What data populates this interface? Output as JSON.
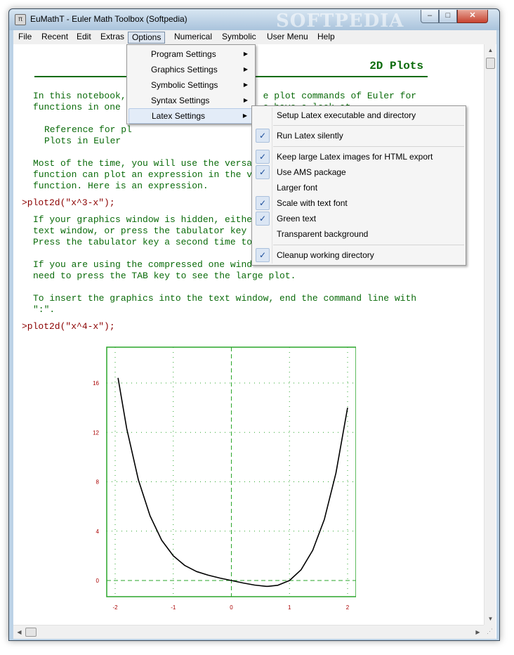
{
  "window": {
    "title": "EuMathT - Euler Math Toolbox (Softpedia)",
    "watermark": "SOFTPEDIA",
    "app_icon_glyph": "π",
    "min_glyph": "–",
    "max_glyph": "□",
    "close_glyph": "✕"
  },
  "menubar": {
    "items": [
      "File",
      "Recent",
      "Edit",
      "Extras",
      "Options",
      "Numerical",
      "Symbolic",
      "User Menu",
      "Help"
    ],
    "active": "Options"
  },
  "options_menu": {
    "items": [
      {
        "label": "Program Settings",
        "submenu": true
      },
      {
        "label": "Graphics Settings",
        "submenu": true
      },
      {
        "label": "Symbolic Settings",
        "submenu": true
      },
      {
        "label": "Syntax Settings",
        "submenu": true
      },
      {
        "label": "Latex Settings",
        "submenu": true
      }
    ],
    "highlighted": "Latex Settings"
  },
  "latex_menu": {
    "items": [
      {
        "label": "Setup Latex executable and directory",
        "checked": false
      },
      {
        "label": "Run Latex silently",
        "checked": true
      },
      {
        "label": "Keep large Latex images for HTML export",
        "checked": true
      },
      {
        "label": "Use AMS package",
        "checked": true
      },
      {
        "label": "Larger font",
        "checked": false
      },
      {
        "label": "Scale with text font",
        "checked": true
      },
      {
        "label": "Green text",
        "checked": true
      },
      {
        "label": "Transparent background",
        "checked": false
      },
      {
        "label": "Cleanup working directory",
        "checked": true
      }
    ]
  },
  "notebook": {
    "heading": "2D Plots",
    "para1_line1": "In this notebook,                         e plot commands of Euler for",
    "para1_line2": "functions in one v                        e have a look at",
    "ref_line1": "Reference for pl",
    "ref_line2": "Plots in Euler",
    "para2_line1": "Most of the time, you will use the versa",
    "para2_line2": "function can plot an expression in the v",
    "para2_line3": "function. Here is an expression.",
    "cmd1": ">plot2d(\"x^3-x\");",
    "para3_line1": "If your graphics window is hidden, eithe",
    "para3_line2": "text window, or press the tabulator key",
    "para3_line3": "Press the tabulator key a second time to",
    "para4_line1": "If you are using the compressed one wind",
    "para4_line2": "need to press the TAB key to see the large plot.",
    "para5_line1": "To insert the graphics into the text window, end the command line with",
    "para5_line2": "\":\".",
    "cmd2": ">plot2d(\"x^4-x\");"
  },
  "chart_data": {
    "type": "line",
    "title": "",
    "xlabel": "",
    "ylabel": "",
    "function": "x^4-x",
    "xlim": [
      -2,
      2
    ],
    "ylim": [
      -1,
      18
    ],
    "x_ticks": [
      -2,
      -1,
      0,
      1,
      2
    ],
    "y_ticks": [
      0,
      4,
      8,
      12,
      16
    ],
    "grid": true,
    "series": [
      {
        "x": [
          -1.95,
          -1.8,
          -1.6,
          -1.4,
          -1.2,
          -1.0,
          -0.8,
          -0.6,
          -0.4,
          -0.2,
          0,
          0.2,
          0.4,
          0.6,
          0.63,
          0.8,
          1.0,
          1.2,
          1.4,
          1.6,
          1.8,
          2.0
        ],
        "y": [
          16.41,
          12.3,
          8.15,
          5.24,
          3.27,
          2.0,
          1.21,
          0.73,
          0.43,
          0.2,
          0.0,
          -0.2,
          -0.37,
          -0.47,
          -0.47,
          -0.39,
          0.0,
          0.87,
          2.44,
          4.95,
          8.7,
          14.0
        ]
      }
    ],
    "colors": {
      "frame": "#2aa52a",
      "grid": "#2aa52a",
      "line": "#000000",
      "tick_labels": "#aa0000"
    }
  }
}
